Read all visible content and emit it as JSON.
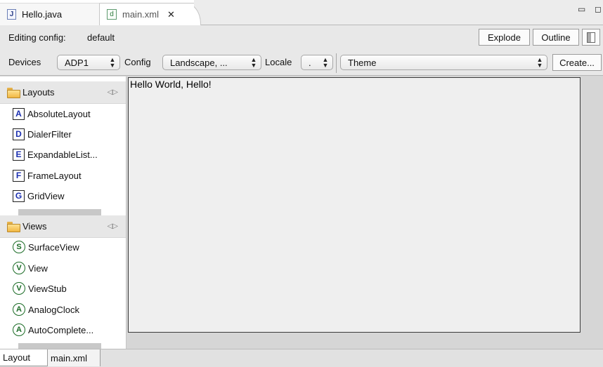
{
  "editor_tabs": [
    {
      "label": "Hello.java",
      "icon": "java-file-icon",
      "icon_glyph": "J",
      "active": false
    },
    {
      "label": "main.xml",
      "icon": "xml-file-icon",
      "icon_glyph": "d",
      "active": true
    }
  ],
  "toolbar": {
    "editing_config_label": "Editing config:",
    "editing_config_value": "default",
    "explode_label": "Explode",
    "outline_label": "Outline",
    "devices_label": "Devices",
    "devices_value": "ADP1",
    "config_label": "Config",
    "config_value": "Landscape, ...",
    "locale_label": "Locale",
    "locale_value": ".",
    "theme_value": "Theme",
    "create_label": "Create..."
  },
  "palette": {
    "layouts": {
      "title": "Layouts",
      "items": [
        {
          "glyph": "A",
          "label": "AbsoluteLayout"
        },
        {
          "glyph": "D",
          "label": "DialerFilter"
        },
        {
          "glyph": "E",
          "label": "ExpandableList..."
        },
        {
          "glyph": "F",
          "label": "FrameLayout"
        },
        {
          "glyph": "G",
          "label": "GridView"
        }
      ]
    },
    "views": {
      "title": "Views",
      "items": [
        {
          "glyph": "S",
          "label": "SurfaceView"
        },
        {
          "glyph": "V",
          "label": "View"
        },
        {
          "glyph": "V",
          "label": "ViewStub"
        },
        {
          "glyph": "A",
          "label": "AnalogClock"
        },
        {
          "glyph": "A",
          "label": "AutoComplete..."
        }
      ]
    }
  },
  "canvas": {
    "text": "Hello World, Hello!"
  },
  "bottom_tabs": [
    {
      "label": "Layout",
      "active": true
    },
    {
      "label": "main.xml",
      "active": false
    }
  ],
  "colors": {
    "layout_glyph": "#1b2fb0",
    "view_glyph": "#1a6b25",
    "folder": "#f1b743"
  }
}
